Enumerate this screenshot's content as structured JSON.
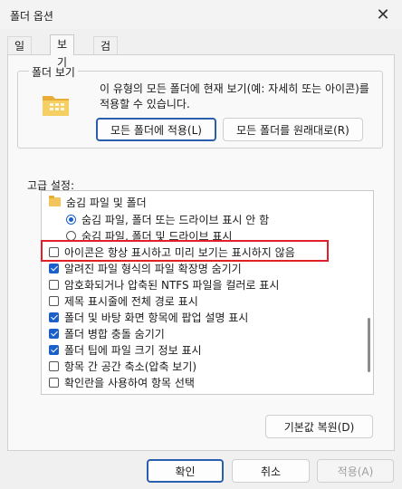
{
  "window": {
    "title": "폴더 옵션"
  },
  "tabs": [
    {
      "label": "일반",
      "active": false
    },
    {
      "label": "보기",
      "active": true
    },
    {
      "label": "검색",
      "active": false
    }
  ],
  "folder_view": {
    "title": "폴더 보기",
    "description": "이 유형의 모든 폴더에 현재 보기(예: 자세히 또는 아이콘)를 적용할 수 있습니다.",
    "apply_button": "모든 폴더에 적용(L)",
    "reset_button": "모든 폴더를 원래대로(R)"
  },
  "advanced": {
    "label": "고급 설정:",
    "items": [
      {
        "type": "folder",
        "label": "숨김 파일 및 폴더"
      },
      {
        "type": "radio",
        "checked": true,
        "label": "숨김 파일, 폴더 또는 드라이브 표시 안 함"
      },
      {
        "type": "radio",
        "checked": false,
        "label": "숨김 파일, 폴더 및 드라이브 표시"
      },
      {
        "type": "checkbox",
        "checked": false,
        "label": "아이콘은 항상 표시하고 미리 보기는 표시하지 않음"
      },
      {
        "type": "checkbox",
        "checked": true,
        "label": "알려진 파일 형식의 파일 확장명 숨기기"
      },
      {
        "type": "checkbox",
        "checked": false,
        "label": "암호화되거나 압축된 NTFS 파일을 컬러로 표시"
      },
      {
        "type": "checkbox",
        "checked": false,
        "label": "제목 표시줄에 전체 경로 표시"
      },
      {
        "type": "checkbox",
        "checked": true,
        "label": "폴더 및 바탕 화면 항목에 팝업 설명 표시"
      },
      {
        "type": "checkbox",
        "checked": true,
        "label": "폴더 병합 충돌 숨기기"
      },
      {
        "type": "checkbox",
        "checked": true,
        "label": "폴더 팁에 파일 크기 정보 표시"
      },
      {
        "type": "checkbox",
        "checked": false,
        "label": "항목 간 공간 축소(압축 보기)"
      },
      {
        "type": "checkbox",
        "checked": false,
        "label": "확인란을 사용하여 항목 선택"
      }
    ],
    "restore_defaults": "기본값 복원(D)"
  },
  "footer": {
    "ok": "확인",
    "cancel": "취소",
    "apply": "적용(A)"
  },
  "colors": {
    "accent": "#1b60c9",
    "highlight": "#e0202a"
  },
  "icons": {
    "close": "close-icon",
    "folder": "folder-icon"
  }
}
